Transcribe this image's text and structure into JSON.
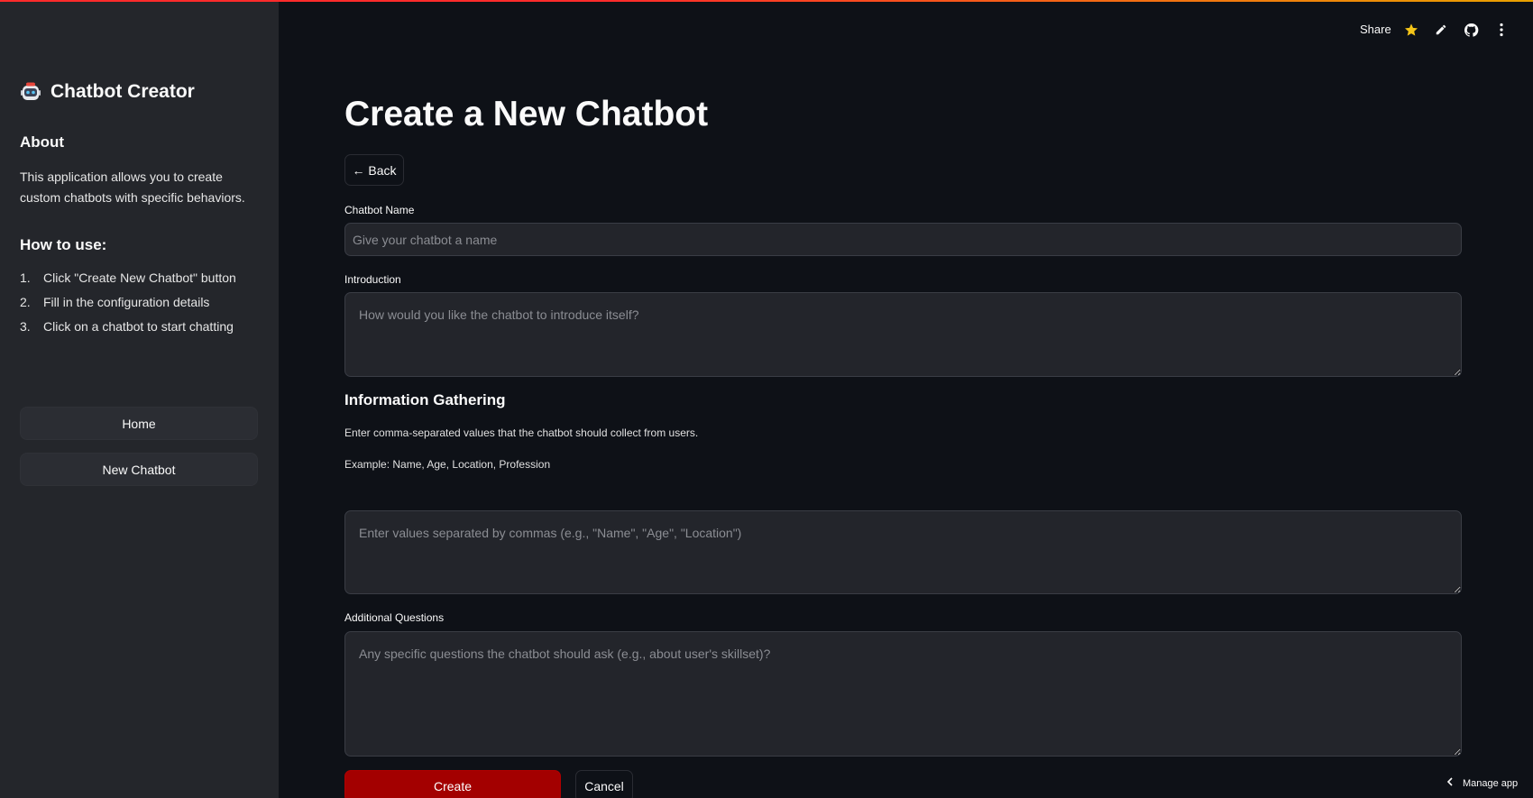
{
  "sidebar": {
    "app_title": "Chatbot Creator",
    "about_heading": "About",
    "about_text": "This application allows you to create custom chatbots with specific behaviors.",
    "howto_heading": "How to use:",
    "steps": [
      {
        "num": "1.",
        "text": "Click \"Create New Chatbot\" button"
      },
      {
        "num": "2.",
        "text": "Fill in the configuration details"
      },
      {
        "num": "3.",
        "text": "Click on a chatbot to start chatting"
      }
    ],
    "home_label": "Home",
    "new_chatbot_label": "New Chatbot"
  },
  "header": {
    "share_label": "Share",
    "icons": [
      "star-icon",
      "pencil-icon",
      "github-icon",
      "more-vertical-icon"
    ]
  },
  "main": {
    "title": "Create a New Chatbot",
    "back_label": "← Back",
    "name_label": "Chatbot Name",
    "name_placeholder": "Give your chatbot a name",
    "intro_label": "Introduction",
    "intro_placeholder": "How would you like the chatbot to introduce itself?",
    "info_heading": "Information Gathering",
    "info_desc": "Enter comma-separated values that the chatbot should collect from users.",
    "info_example": "Example: Name, Age, Location, Profession",
    "info_placeholder": "Enter values separated by commas (e.g., \"Name\", \"Age\", \"Location\")",
    "additional_label": "Additional Questions",
    "additional_placeholder": "Any specific questions the chatbot should ask (e.g., about user's skillset)?",
    "create_label": "Create",
    "cancel_label": "Cancel"
  },
  "footer": {
    "manage_label": "Manage app"
  },
  "colors": {
    "background": "#0e1117",
    "sidebar": "#24262b",
    "primary_button": "#a30000",
    "star": "#f5c518"
  }
}
